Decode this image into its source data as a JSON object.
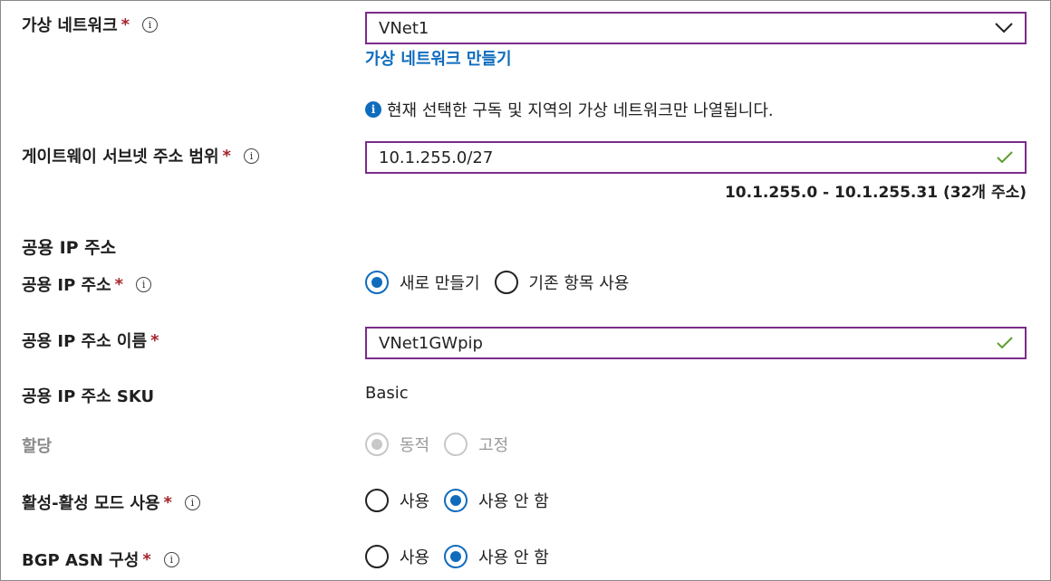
{
  "vnet": {
    "label": "가상 네트워크",
    "value": "VNet1",
    "create_link": "가상 네트워크 만들기",
    "note": "현재 선택한 구독 및 지역의 가상 네트워크만 나열됩니다."
  },
  "gateway_subnet": {
    "label": "게이트웨이 서브넷 주소 범위",
    "value": "10.1.255.0/27",
    "range": "10.1.255.0 - 10.1.255.31 (32개 주소)"
  },
  "public_ip_section": {
    "title": "공용 IP 주소"
  },
  "public_ip": {
    "label": "공용 IP 주소",
    "options": [
      "새로 만들기",
      "기존 항목 사용"
    ],
    "selected": "새로 만들기"
  },
  "public_ip_name": {
    "label": "공용 IP 주소 이름",
    "value": "VNet1GWpip"
  },
  "public_ip_sku": {
    "label": "공용 IP 주소 SKU",
    "value": "Basic"
  },
  "assignment": {
    "label": "할당",
    "options": [
      "동적",
      "고정"
    ],
    "selected": "동적",
    "disabled": true
  },
  "active_active": {
    "label": "활성-활성 모드 사용",
    "options": [
      "사용",
      "사용 안 함"
    ],
    "selected": "사용 안 함"
  },
  "bgp_asn": {
    "label": "BGP ASN 구성",
    "options": [
      "사용",
      "사용 안 함"
    ],
    "selected": "사용 안 함"
  },
  "icons": {
    "info": "info-icon",
    "check": "checkmark-icon",
    "dropdown": "chevron-down-icon"
  },
  "colors": {
    "field_border": "#7b2b8b",
    "link": "#0f6cbd",
    "required": "#a4262c",
    "valid_check": "#5c9e2c"
  },
  "required_marker": "*",
  "info_glyph": "i"
}
